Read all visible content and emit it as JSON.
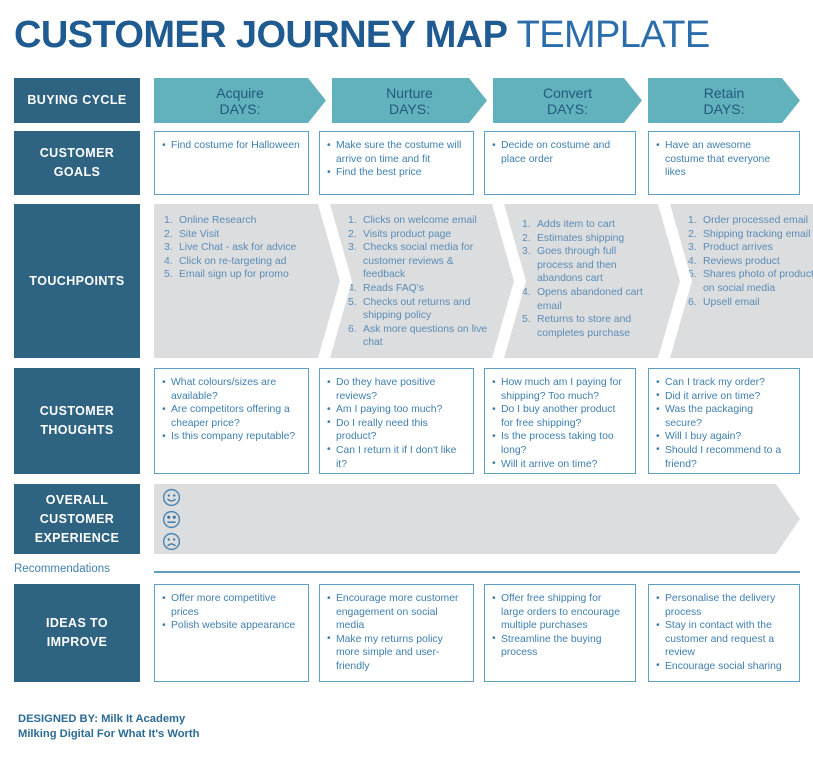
{
  "title": {
    "bold": "CUSTOMER JOURNEY MAP",
    "light": "TEMPLATE"
  },
  "colors": {
    "label_bg": "#2e6382",
    "header_chevron": "#62b2bd",
    "touchpoint_chevron": "#dcdddf",
    "card_border": "#5f9fc6",
    "body_text": "#3f7fae",
    "title_bold": "#1f5b91",
    "title_light": "#2b6daa"
  },
  "rows": {
    "buying_cycle": {
      "label": "BUYING CYCLE",
      "stages": [
        {
          "name": "Acquire",
          "days": "DAYS:"
        },
        {
          "name": "Nurture",
          "days": "DAYS:"
        },
        {
          "name": "Convert",
          "days": "DAYS:"
        },
        {
          "name": "Retain",
          "days": "DAYS:"
        }
      ]
    },
    "customer_goals": {
      "label_line1": "CUSTOMER",
      "label_line2": "GOALS",
      "columns": [
        [
          "Find costume for Halloween"
        ],
        [
          "Make sure the costume will arrive on time and fit",
          "Find the best price"
        ],
        [
          "Decide on costume and place order"
        ],
        [
          "Have an awesome costume that everyone likes"
        ]
      ]
    },
    "touchpoints": {
      "label": "TOUCHPOINTS",
      "columns": [
        [
          "Online Research",
          "Site Visit",
          "Live Chat - ask for advice",
          "Click on re-targeting ad",
          "Email sign up for promo"
        ],
        [
          "Clicks on welcome email",
          "Visits product page",
          "Checks social media for customer reviews & feedback",
          "Reads FAQ's",
          "Checks out returns and shipping policy",
          "Ask more questions on live chat"
        ],
        [
          "Adds item to cart",
          "Estimates shipping",
          "Goes through full process and then abandons cart",
          "Opens abandoned cart email",
          "Returns to store and completes purchase"
        ],
        [
          "Order processed email",
          "Shipping tracking email",
          "Product arrives",
          "Reviews product",
          "Shares photo of product on social media",
          "Upsell email"
        ]
      ]
    },
    "customer_thoughts": {
      "label_line1": "CUSTOMER",
      "label_line2": "THOUGHTS",
      "columns": [
        [
          "What colours/sizes are available?",
          "Are competitors offering a cheaper price?",
          "Is this company reputable?"
        ],
        [
          "Do they have positive reviews?",
          "Am I paying too much?",
          "Do I really need this product?",
          "Can I return it if I don't like it?"
        ],
        [
          "How much am I paying for shipping? Too much?",
          "Do I buy another product for free shipping?",
          "Is the process taking too long?",
          "Will it arrive on time?"
        ],
        [
          "Can I track my order?",
          "Did it arrive on time?",
          "Was the packaging secure?",
          "Will I buy again?",
          "Should I recommend to a friend?"
        ]
      ]
    },
    "overall_experience": {
      "label_line1": "OVERALL",
      "label_line2": "CUSTOMER",
      "label_line3": "EXPERIENCE",
      "faces": [
        "happy-face-icon",
        "neutral-face-icon",
        "sad-face-icon"
      ]
    },
    "recommendations": {
      "label": "Recommendations"
    },
    "ideas_to_improve": {
      "label_line1": "IDEAS TO",
      "label_line2": "IMPROVE",
      "columns": [
        [
          "Offer more competitive prices",
          "Polish website appearance"
        ],
        [
          "Encourage more customer engagement on social media",
          "Make my returns policy more simple and user-friendly"
        ],
        [
          "Offer free shipping for large orders to encourage multiple purchases",
          "Streamline the buying process"
        ],
        [
          "Personalise the delivery process",
          "Stay in contact with the customer and request a review",
          "Encourage social sharing"
        ]
      ]
    }
  },
  "footer": {
    "line1": "DESIGNED BY: Milk It Academy",
    "line2": "Milking Digital For What It's Worth"
  }
}
